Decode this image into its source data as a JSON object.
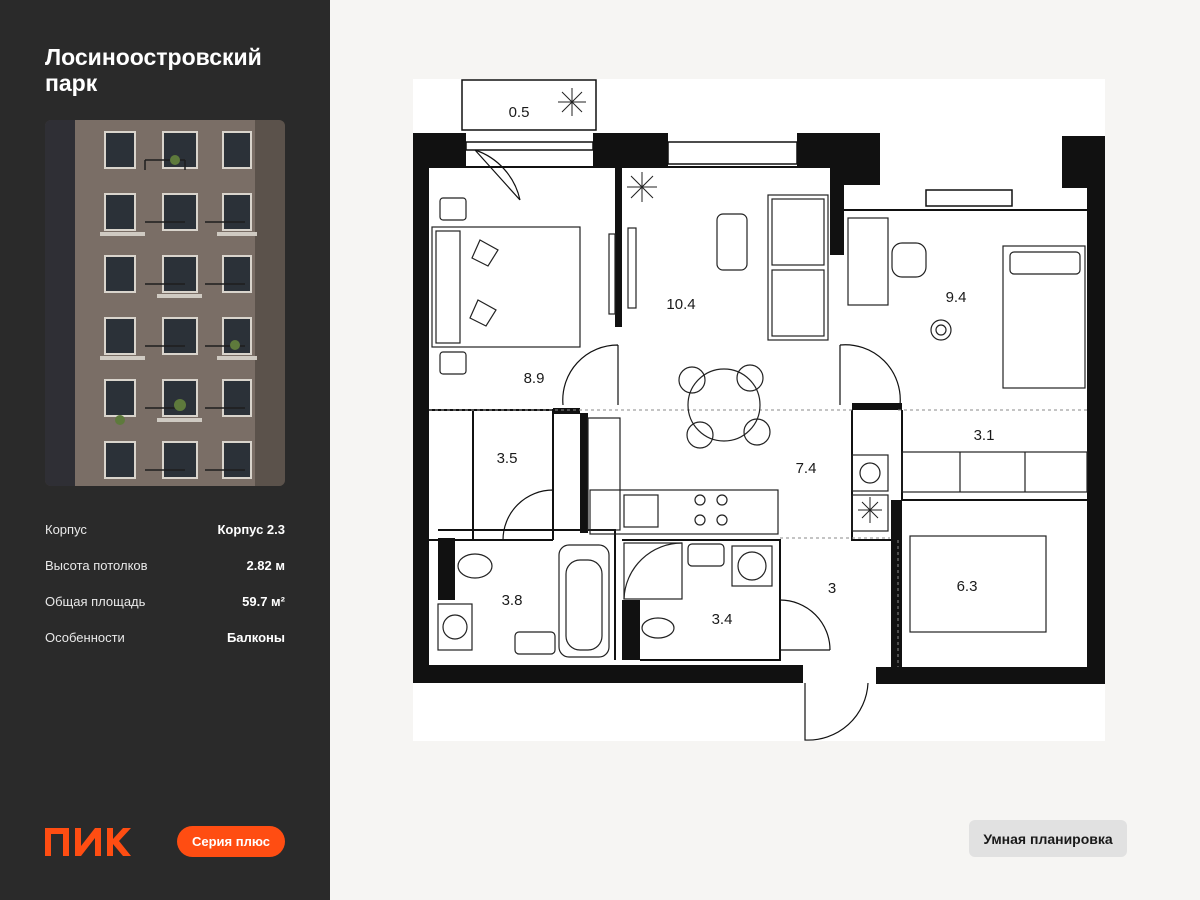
{
  "project": {
    "title": "Лосиноостровский парк"
  },
  "specs": [
    {
      "label": "Корпус",
      "value": "Корпус 2.3"
    },
    {
      "label": "Высота потолков",
      "value": "2.82 м"
    },
    {
      "label": "Общая площадь",
      "value": "59.7 м²"
    },
    {
      "label": "Особенности",
      "value": "Балконы"
    }
  ],
  "brand": {
    "logo_text": "ПИК",
    "accent": "#ff4d12"
  },
  "series_button": {
    "label": "Серия плюс"
  },
  "smart_button": {
    "label": "Умная планировка"
  },
  "rooms": [
    {
      "area": "0.5"
    },
    {
      "area": "8.9"
    },
    {
      "area": "10.4"
    },
    {
      "area": "9.4"
    },
    {
      "area": "3.5"
    },
    {
      "area": "7.4"
    },
    {
      "area": "3.1"
    },
    {
      "area": "3.8"
    },
    {
      "area": "3.4"
    },
    {
      "area": "3"
    },
    {
      "area": "6.3"
    }
  ]
}
